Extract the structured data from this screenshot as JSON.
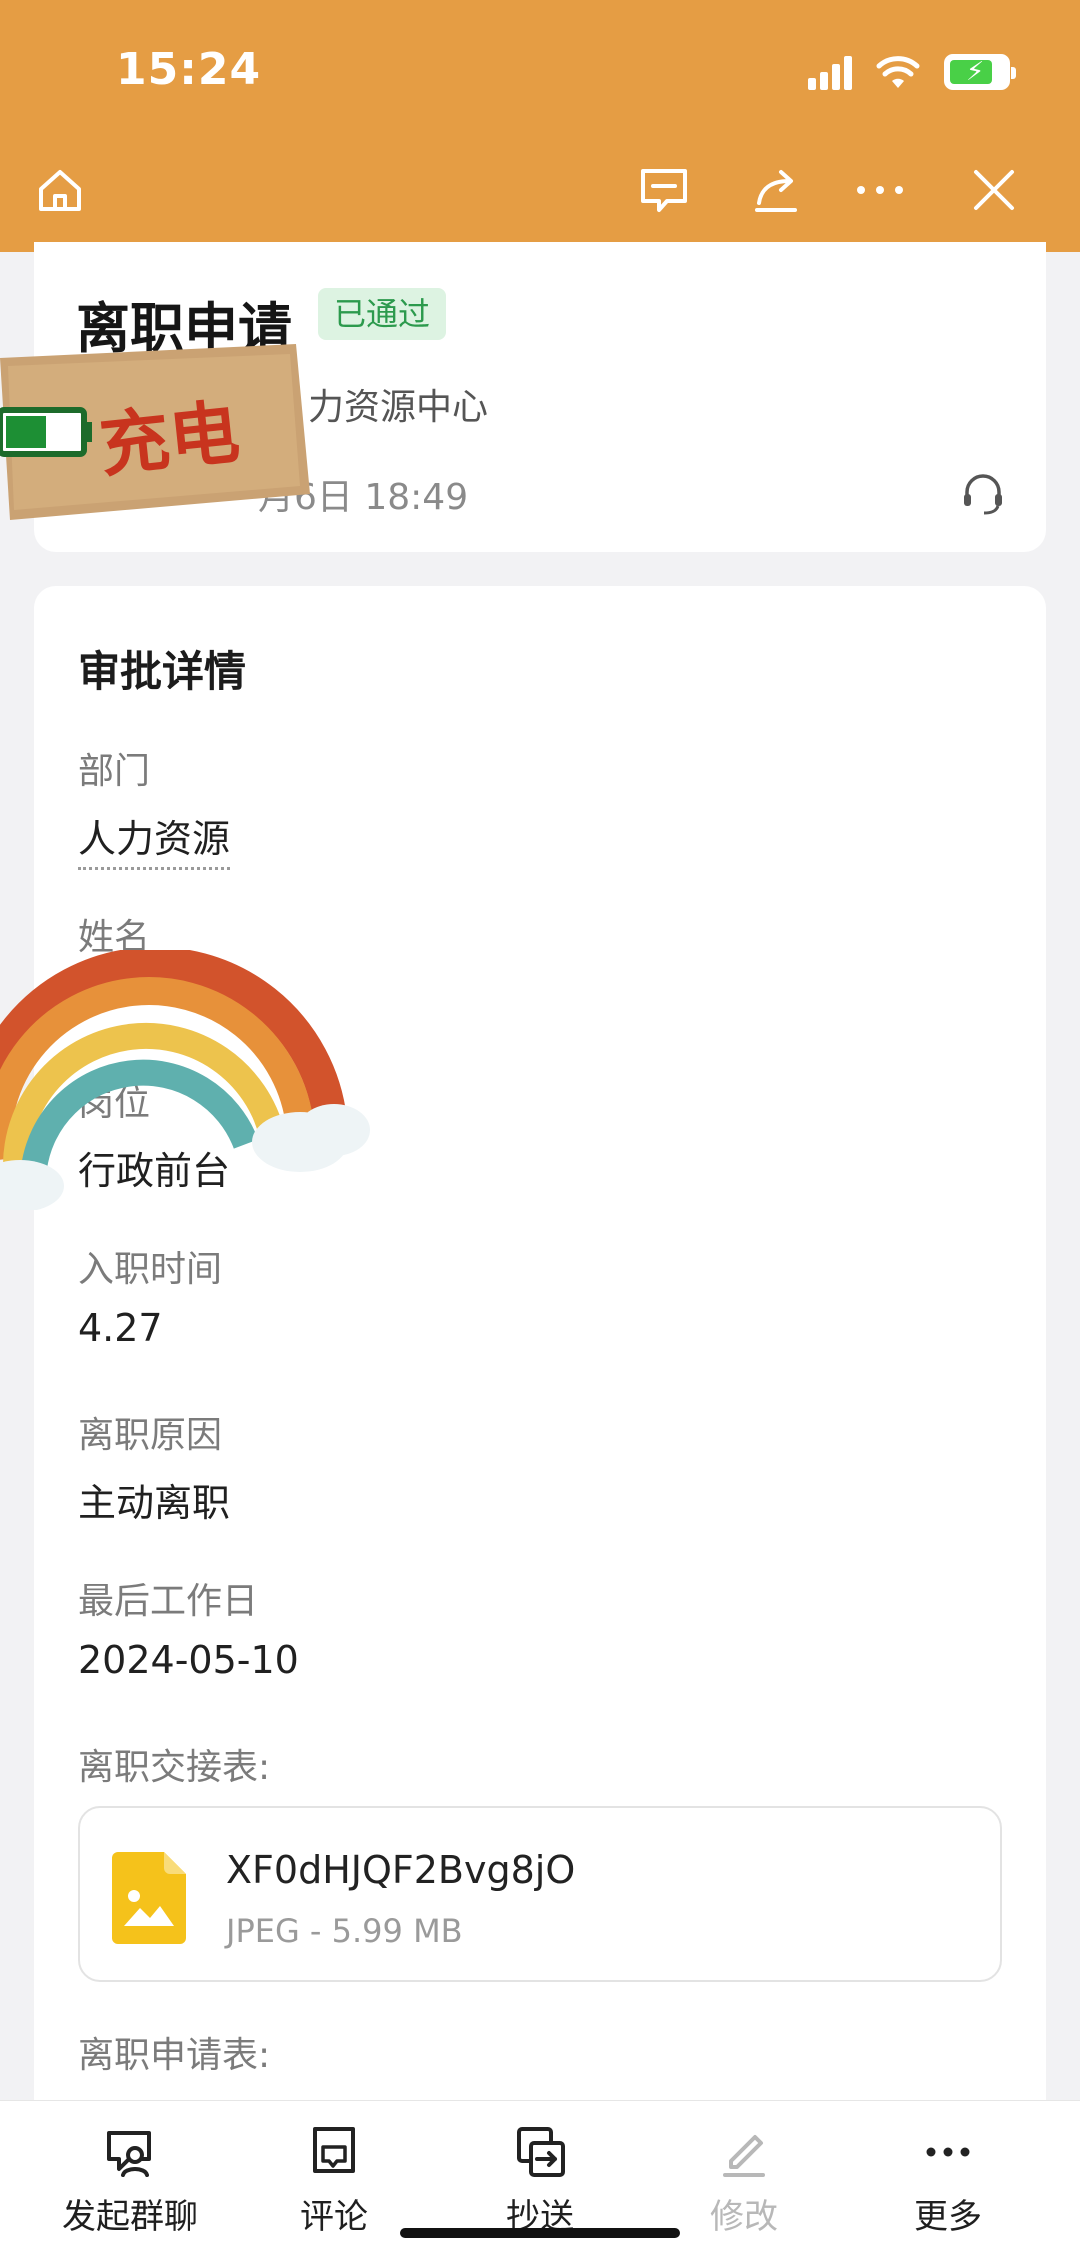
{
  "status_bar": {
    "time": "15:24"
  },
  "header_card": {
    "title": "离职申请",
    "status_badge": "已通过",
    "department_text": "力资源中心",
    "time_text": "月6日 18:49"
  },
  "sticker_charge": {
    "text": "充电"
  },
  "detail": {
    "section_title": "审批详情",
    "fields": [
      {
        "label": "部门",
        "value": "人力资源"
      },
      {
        "label": "姓名",
        "value": ""
      },
      {
        "label": "岗位",
        "value": "行政前台"
      },
      {
        "label": "入职时间",
        "value": "4.27"
      },
      {
        "label": "离职原因",
        "value": "主动离职"
      },
      {
        "label": "最后工作日",
        "value": "2024-05-10"
      }
    ],
    "handover_label": "离职交接表:",
    "handover_file": {
      "name": "XF0dHJQF2Bvg8jO",
      "meta": "JPEG - 5.99 MB"
    },
    "application_label": "离职申请表:"
  },
  "bottom_bar": {
    "items": [
      {
        "label": "发起群聊",
        "icon": "group-chat-icon"
      },
      {
        "label": "评论",
        "icon": "comment-icon"
      },
      {
        "label": "抄送",
        "icon": "cc-icon"
      },
      {
        "label": "修改",
        "icon": "edit-icon"
      },
      {
        "label": "更多",
        "icon": "more-icon"
      }
    ]
  },
  "colors": {
    "header_bg": "#e59d44",
    "badge_bg": "#ddf3e2",
    "badge_text": "#2c9a4d",
    "file_icon": "#f5c21b"
  }
}
